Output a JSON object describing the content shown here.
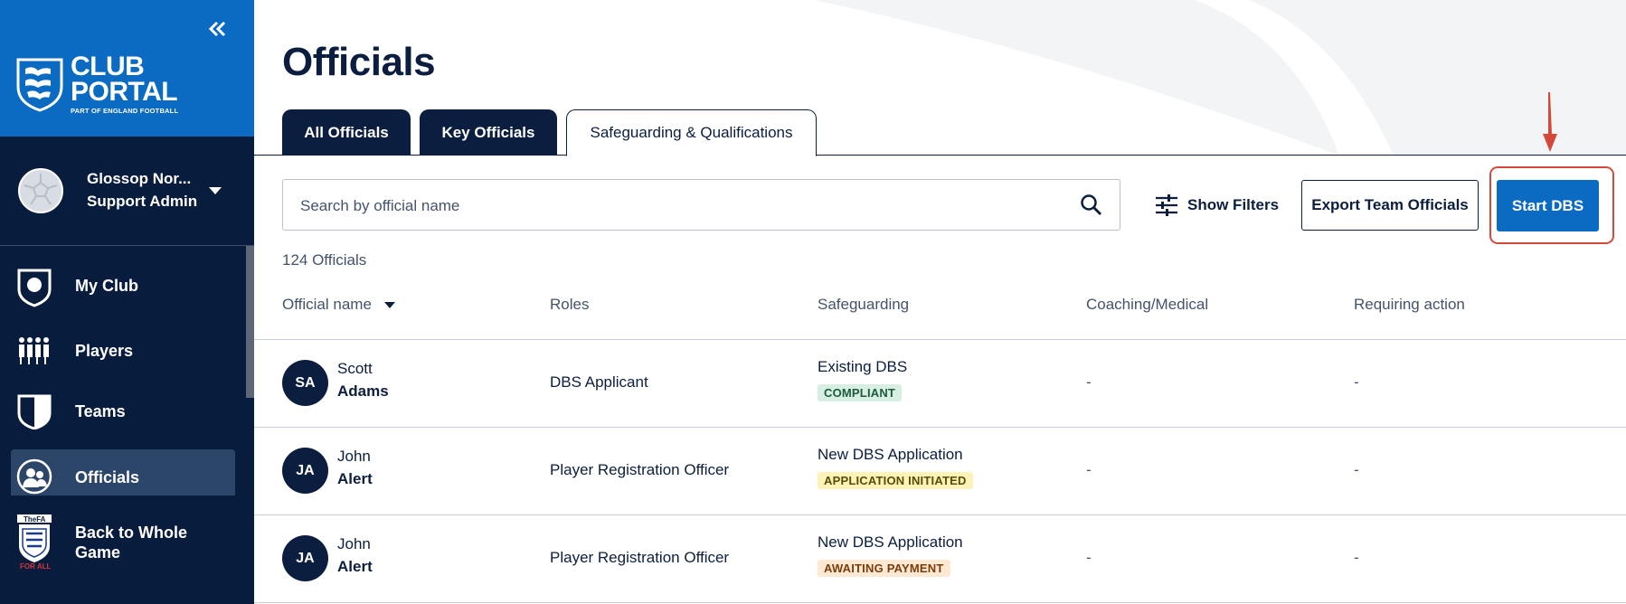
{
  "sidebar": {
    "logo": {
      "line1": "CLUB",
      "line2": "PORTAL",
      "tagline": "PART OF ENGLAND FOOTBALL"
    },
    "profile": {
      "name": "Glossop Nor...",
      "role": "Support Admin"
    },
    "items": [
      {
        "label": "My Club",
        "icon": "club-shield-icon"
      },
      {
        "label": "Players",
        "icon": "players-icon"
      },
      {
        "label": "Teams",
        "icon": "teams-shield-icon"
      },
      {
        "label": "Officials",
        "icon": "officials-icon"
      },
      {
        "label_line1": "Back to Whole",
        "label_line2": "Game",
        "icon": "fa-crest-icon",
        "crest_text": "TheFA",
        "crest_sub": "FOR ALL"
      }
    ]
  },
  "main": {
    "title": "Officials",
    "tabs": [
      {
        "label": "All Officials",
        "active": false
      },
      {
        "label": "Key Officials",
        "active": false
      },
      {
        "label": "Safeguarding & Qualifications",
        "active": true
      }
    ],
    "search": {
      "placeholder": "Search by official name"
    },
    "filters_label": "Show Filters",
    "export_label": "Export Team Officials",
    "start_dbs_label": "Start DBS",
    "count_text": "124 Officials",
    "columns": [
      "Official name",
      "Roles",
      "Safeguarding",
      "Coaching/Medical",
      "Requiring action"
    ],
    "rows": [
      {
        "initials": "SA",
        "first": "Scott",
        "last": "Adams",
        "role": "DBS Applicant",
        "safeguarding": "Existing DBS",
        "badge": "COMPLIANT",
        "badge_bg": "#d6efe2",
        "badge_fg": "#1d5a3a",
        "coaching": "-",
        "action": "-"
      },
      {
        "initials": "JA",
        "first": "John",
        "last": "Alert",
        "role": "Player Registration Officer",
        "safeguarding": "New DBS Application",
        "badge": "APPLICATION INITIATED",
        "badge_bg": "#fdf3b8",
        "badge_fg": "#5a4a06",
        "coaching": "-",
        "action": "-"
      },
      {
        "initials": "JA",
        "first": "John",
        "last": "Alert",
        "role": "Player Registration Officer",
        "safeguarding": "New DBS Application",
        "badge": "AWAITING PAYMENT",
        "badge_bg": "#fde8d4",
        "badge_fg": "#7a3d0a",
        "coaching": "-",
        "action": "-"
      }
    ]
  },
  "colors": {
    "navy": "#0b1e3f",
    "brand_blue": "#0b6ac1",
    "highlight": "#d44a3a"
  }
}
